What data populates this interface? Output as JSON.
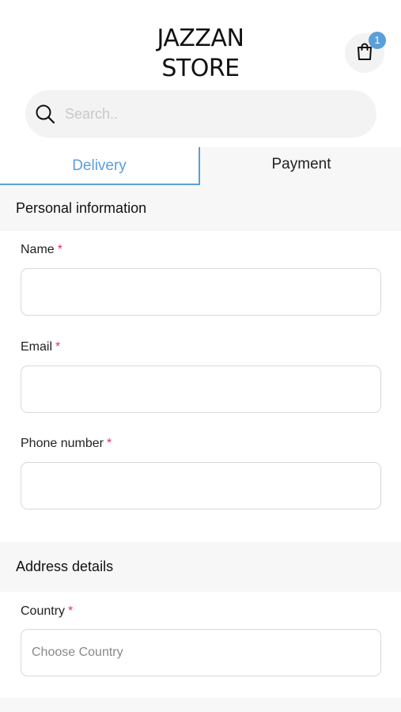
{
  "header": {
    "logo_line1": "JAZZAN",
    "logo_line2": "STORE",
    "cart_count": "1"
  },
  "search": {
    "placeholder": "Search.."
  },
  "tabs": [
    {
      "label": "Delivery",
      "active": true
    },
    {
      "label": "Payment",
      "active": false
    }
  ],
  "personal": {
    "title": "Personal information",
    "name_label": "Name",
    "email_label": "Email",
    "phone_label": "Phone number",
    "required_mark": "*",
    "name_value": "",
    "email_value": "",
    "phone_value": ""
  },
  "address": {
    "title": "Address details",
    "country_label": "Country",
    "country_placeholder": "Choose Country"
  },
  "colors": {
    "accent": "#5b9fd9",
    "required": "#e0355a",
    "section_bg": "#f7f7f7"
  },
  "icons": {
    "cart": "shopping-bag-icon",
    "search": "search-icon"
  }
}
